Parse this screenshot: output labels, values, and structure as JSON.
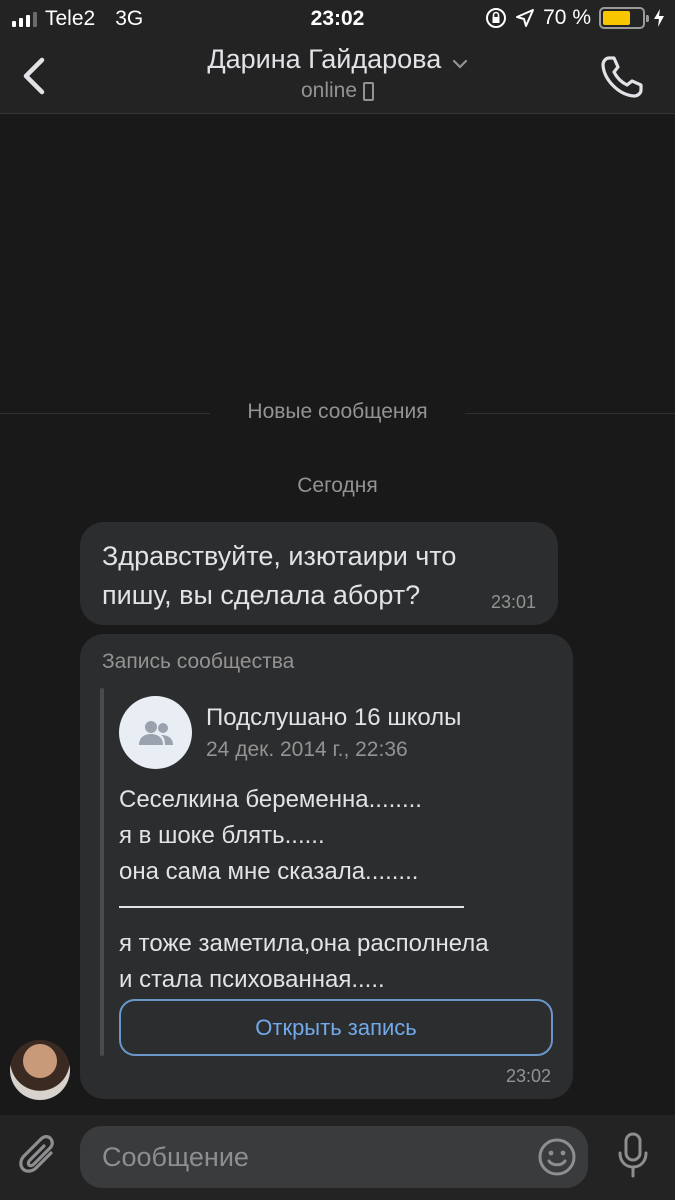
{
  "status_bar": {
    "carrier": "Tele2",
    "network": "3G",
    "time": "23:02",
    "battery_percent": "70 %",
    "battery_level": 0.7,
    "battery_color": "#f7c600"
  },
  "header": {
    "title": "Дарина Гайдарова",
    "status": "online",
    "icons": [
      "back-icon",
      "chevron-down-icon",
      "mobile-phone-icon",
      "phone-call-icon"
    ]
  },
  "chat": {
    "new_messages_label": "Новые сообщения",
    "date_label": "Сегодня",
    "message": {
      "text": "Здравствуйте, изютаири что пишу, вы сделала аборт?",
      "time": "23:01"
    },
    "post": {
      "label": "Запись сообщества",
      "community_name": "Подслушано 16 школы",
      "date": "24 дек. 2014 г., 22:36",
      "lines": [
        "Сеселкина беременна........",
        "я в шоке блять......",
        "она сама мне сказала........",
        "я тоже заметила,она располнела",
        "и стала психованная....."
      ],
      "open_button": "Открыть запись",
      "time": "23:02"
    }
  },
  "composer": {
    "placeholder": "Сообщение",
    "icons": [
      "paperclip-icon",
      "emoji-icon",
      "microphone-icon"
    ]
  },
  "colors": {
    "background": "#19191a",
    "bubble": "#2c2d2e",
    "accent": "#71aaeb"
  }
}
